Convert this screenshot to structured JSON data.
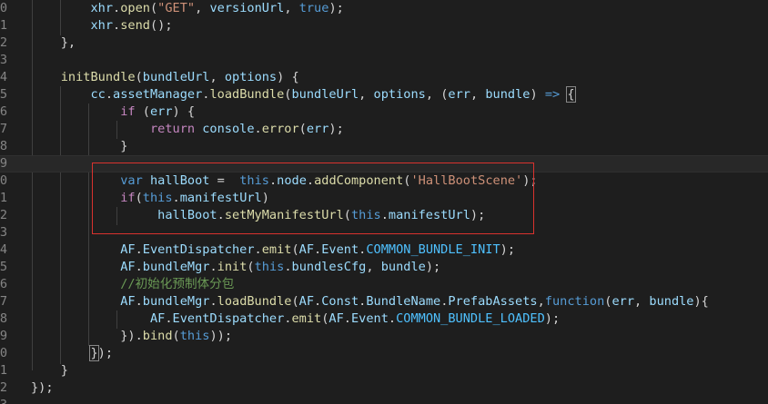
{
  "editor": {
    "lines": [
      {
        "n": "0",
        "tokens": [
          [
            "",
            "        "
          ],
          [
            "var",
            "xhr"
          ],
          [
            "",
            "."
          ],
          [
            "fn",
            "open"
          ],
          [
            "",
            "("
          ],
          [
            "str",
            "\"GET\""
          ],
          [
            "",
            ", "
          ],
          [
            "var",
            "versionUrl"
          ],
          [
            "",
            ", "
          ],
          [
            "kw",
            "true"
          ],
          [
            "",
            ");"
          ]
        ]
      },
      {
        "n": "1",
        "tokens": [
          [
            "",
            "        "
          ],
          [
            "var",
            "xhr"
          ],
          [
            "",
            "."
          ],
          [
            "fn",
            "send"
          ],
          [
            "",
            "();"
          ]
        ]
      },
      {
        "n": "2",
        "tokens": [
          [
            "",
            "    },"
          ]
        ]
      },
      {
        "n": "3",
        "tokens": [
          [
            "",
            ""
          ]
        ]
      },
      {
        "n": "4",
        "tokens": [
          [
            "",
            "    "
          ],
          [
            "fn",
            "initBundle"
          ],
          [
            "",
            "("
          ],
          [
            "var",
            "bundleUrl"
          ],
          [
            "",
            ", "
          ],
          [
            "var",
            "options"
          ],
          [
            "",
            ") {"
          ]
        ]
      },
      {
        "n": "5",
        "tokens": [
          [
            "",
            "        "
          ],
          [
            "var",
            "cc"
          ],
          [
            "",
            "."
          ],
          [
            "var",
            "assetManager"
          ],
          [
            "",
            "."
          ],
          [
            "fn",
            "loadBundle"
          ],
          [
            "",
            "("
          ],
          [
            "var",
            "bundleUrl"
          ],
          [
            "",
            ", "
          ],
          [
            "var",
            "options"
          ],
          [
            "",
            ", ("
          ],
          [
            "var",
            "err"
          ],
          [
            "",
            ", "
          ],
          [
            "var",
            "bundle"
          ],
          [
            "",
            ") "
          ],
          [
            "kw",
            "=>"
          ],
          [
            "",
            " "
          ],
          [
            "bm",
            "{"
          ]
        ]
      },
      {
        "n": "6",
        "tokens": [
          [
            "",
            "            "
          ],
          [
            "ctl",
            "if"
          ],
          [
            "",
            " ("
          ],
          [
            "var",
            "err"
          ],
          [
            "",
            ") {"
          ]
        ]
      },
      {
        "n": "7",
        "tokens": [
          [
            "",
            "                "
          ],
          [
            "ctl",
            "return"
          ],
          [
            "",
            " "
          ],
          [
            "var",
            "console"
          ],
          [
            "",
            "."
          ],
          [
            "fn",
            "error"
          ],
          [
            "",
            "("
          ],
          [
            "var",
            "err"
          ],
          [
            "",
            ");"
          ]
        ]
      },
      {
        "n": "8",
        "tokens": [
          [
            "",
            "            }"
          ]
        ]
      },
      {
        "n": "9",
        "tokens": [
          [
            "",
            ""
          ]
        ]
      },
      {
        "n": "0",
        "tokens": [
          [
            "",
            "            "
          ],
          [
            "kw",
            "var"
          ],
          [
            "",
            " "
          ],
          [
            "var",
            "hallBoot"
          ],
          [
            "",
            " =  "
          ],
          [
            "kw",
            "this"
          ],
          [
            "",
            "."
          ],
          [
            "var",
            "node"
          ],
          [
            "",
            "."
          ],
          [
            "fn",
            "addComponent"
          ],
          [
            "",
            "("
          ],
          [
            "str",
            "'HallBootScene'"
          ],
          [
            "",
            ");"
          ]
        ]
      },
      {
        "n": "1",
        "tokens": [
          [
            "",
            "            "
          ],
          [
            "ctl",
            "if"
          ],
          [
            "",
            "("
          ],
          [
            "kw",
            "this"
          ],
          [
            "",
            "."
          ],
          [
            "var",
            "manifestUrl"
          ],
          [
            "",
            ")"
          ]
        ]
      },
      {
        "n": "2",
        "tokens": [
          [
            "",
            "                 "
          ],
          [
            "var",
            "hallBoot"
          ],
          [
            "",
            "."
          ],
          [
            "fn",
            "setMyManifestUrl"
          ],
          [
            "",
            "("
          ],
          [
            "kw",
            "this"
          ],
          [
            "",
            "."
          ],
          [
            "var",
            "manifestUrl"
          ],
          [
            "",
            ");"
          ]
        ]
      },
      {
        "n": "3",
        "tokens": [
          [
            "",
            ""
          ]
        ]
      },
      {
        "n": "4",
        "tokens": [
          [
            "",
            "            "
          ],
          [
            "var",
            "AF"
          ],
          [
            "",
            "."
          ],
          [
            "var",
            "EventDispatcher"
          ],
          [
            "",
            "."
          ],
          [
            "fn",
            "emit"
          ],
          [
            "",
            "("
          ],
          [
            "var",
            "AF"
          ],
          [
            "",
            "."
          ],
          [
            "var",
            "Event"
          ],
          [
            "",
            "."
          ],
          [
            "cst",
            "COMMON_BUNDLE_INIT"
          ],
          [
            "",
            ");"
          ]
        ]
      },
      {
        "n": "5",
        "tokens": [
          [
            "",
            "            "
          ],
          [
            "var",
            "AF"
          ],
          [
            "",
            "."
          ],
          [
            "var",
            "bundleMgr"
          ],
          [
            "",
            "."
          ],
          [
            "fn",
            "init"
          ],
          [
            "",
            "("
          ],
          [
            "kw",
            "this"
          ],
          [
            "",
            "."
          ],
          [
            "var",
            "bundlesCfg"
          ],
          [
            "",
            ", "
          ],
          [
            "var",
            "bundle"
          ],
          [
            "",
            ");"
          ]
        ]
      },
      {
        "n": "6",
        "tokens": [
          [
            "",
            "            "
          ],
          [
            "cmt",
            "//初始化预制体分包"
          ]
        ]
      },
      {
        "n": "7",
        "tokens": [
          [
            "",
            "            "
          ],
          [
            "var",
            "AF"
          ],
          [
            "",
            "."
          ],
          [
            "var",
            "bundleMgr"
          ],
          [
            "",
            "."
          ],
          [
            "fn",
            "loadBundle"
          ],
          [
            "",
            "("
          ],
          [
            "var",
            "AF"
          ],
          [
            "",
            "."
          ],
          [
            "var",
            "Const"
          ],
          [
            "",
            "."
          ],
          [
            "var",
            "BundleName"
          ],
          [
            "",
            "."
          ],
          [
            "var",
            "PrefabAssets"
          ],
          [
            "",
            ","
          ],
          [
            "kw",
            "function"
          ],
          [
            "",
            "("
          ],
          [
            "var",
            "err"
          ],
          [
            "",
            ", "
          ],
          [
            "var",
            "bundle"
          ],
          [
            "",
            "){"
          ]
        ]
      },
      {
        "n": "8",
        "tokens": [
          [
            "",
            "                "
          ],
          [
            "var",
            "AF"
          ],
          [
            "",
            "."
          ],
          [
            "var",
            "EventDispatcher"
          ],
          [
            "",
            "."
          ],
          [
            "fn",
            "emit"
          ],
          [
            "",
            "("
          ],
          [
            "var",
            "AF"
          ],
          [
            "",
            "."
          ],
          [
            "var",
            "Event"
          ],
          [
            "",
            "."
          ],
          [
            "cst",
            "COMMON_BUNDLE_LOADED"
          ],
          [
            "",
            ");"
          ]
        ]
      },
      {
        "n": "9",
        "tokens": [
          [
            "",
            "            })."
          ],
          [
            "fn",
            "bind"
          ],
          [
            "",
            "("
          ],
          [
            "kw",
            "this"
          ],
          [
            "",
            "));"
          ]
        ]
      },
      {
        "n": "0",
        "tokens": [
          [
            "",
            "        "
          ],
          [
            "bm",
            "}"
          ],
          [
            "",
            ");"
          ]
        ]
      },
      {
        "n": "1",
        "tokens": [
          [
            "",
            "    }"
          ]
        ]
      },
      {
        "n": "2",
        "tokens": [
          [
            "",
            "});"
          ]
        ]
      },
      {
        "n": "3",
        "tokens": [
          [
            "",
            ""
          ]
        ]
      }
    ]
  }
}
